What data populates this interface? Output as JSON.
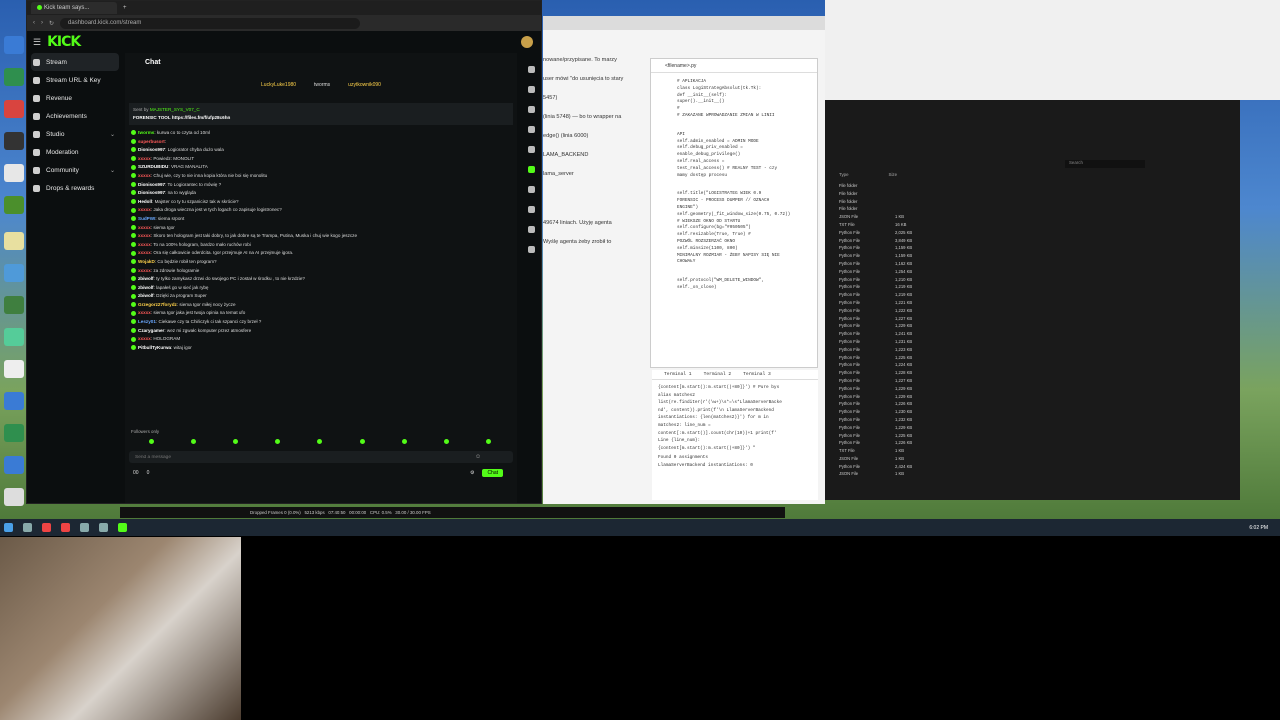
{
  "browser": {
    "tab_title": "Kick team says...",
    "url": "dashboard.kick.com/stream"
  },
  "kick": {
    "logo": "KICK",
    "sidebar": [
      {
        "label": "Stream",
        "icon": "stream-icon",
        "active": true
      },
      {
        "label": "Stream URL & Key",
        "icon": "key-icon"
      },
      {
        "label": "Revenue",
        "icon": "revenue-icon"
      },
      {
        "label": "Achievements",
        "icon": "trophy-icon"
      },
      {
        "label": "Studio",
        "icon": "studio-icon",
        "expandable": true
      },
      {
        "label": "Moderation",
        "icon": "shield-icon"
      },
      {
        "label": "Community",
        "icon": "community-icon",
        "expandable": true
      },
      {
        "label": "Drops & rewards",
        "icon": "gift-icon"
      }
    ],
    "chat": {
      "title": "Chat",
      "top_users": [
        {
          "name": "LuckyLuke1980",
          "value": "1"
        },
        {
          "name": "tworms",
          "value": "1"
        },
        {
          "name": "uzytkownik090",
          "value": "1"
        }
      ],
      "pinned": {
        "sender": "MAJSTER_SYS_V07_C",
        "text": "FORENSIC TOOL https://files.fm/f/ufp28c6hn"
      },
      "messages": [
        {
          "user": "tworms",
          "text": "kurwa co to czyta od 10ml",
          "color": "#53fc18"
        },
        {
          "user": "superbusort",
          "text": "",
          "color": "#ff5a5a"
        },
        {
          "user": "Dionisos997",
          "text": "Logiorator chyba dużo wala",
          "color": "#fff"
        },
        {
          "user": "xxxxx",
          "text": "Powiedz: MONOLIT",
          "color": "#ff5a5a"
        },
        {
          "user": "SZURDUBIDU",
          "text": "VRAG MANALITA",
          "color": "#fff"
        },
        {
          "user": "xxxxx",
          "text": "Chuj wie, czy to nie inna kopia która nie boi się monolitu",
          "color": "#ff5a5a"
        },
        {
          "user": "Dionisos997",
          "text": "To Logiorantec to mówię ?",
          "color": "#fff"
        },
        {
          "user": "Dionisos997",
          "text": "na to wygląda",
          "color": "#fff"
        },
        {
          "user": "Hedoll",
          "text": "Majster co ty tu szpanicisz tak w skrócie?",
          "color": "#fff"
        },
        {
          "user": "xxxxx",
          "text": "Jaka droga wieczna jest w tych logach co zapisuje logistronec?",
          "color": "#ff5a5a"
        },
        {
          "user": "SudPWI",
          "text": "siema srpont",
          "color": "#6aa8ff"
        },
        {
          "user": "xxxxx",
          "text": "siema Igor",
          "color": "#ff5a5a"
        },
        {
          "user": "xxxxx",
          "text": "Skoro ten hologram jest taki dobry, to jak dobre są te Trampa, Putina, Muska i chuj wie kogo jeszcze",
          "color": "#ff5a5a"
        },
        {
          "user": "xxxxx",
          "text": "To na 100% hologram, bardzo mało ruchów robi",
          "color": "#ff5a5a"
        },
        {
          "user": "xxxxx",
          "text": "Ora się całkowicie oderdcita. Igor przejmuje AI na AI przejmuje igora.",
          "color": "#ff5a5a"
        },
        {
          "user": "WojakD",
          "text": "Co będzie robił ten program?",
          "color": "#ffd24a"
        },
        {
          "user": "xxxxx",
          "text": "za zdrowie hologramie",
          "color": "#ff5a5a"
        },
        {
          "user": "zbiwolf",
          "text": "ty tylko zamykasz drzwi do swojego PC i został w środku , to nie krzdzie?",
          "color": "#fff"
        },
        {
          "user": "zbiwolf",
          "text": "lapałeś go w sieć jak rybę",
          "color": "#fff"
        },
        {
          "user": "zbiwolf",
          "text": "Dzięki za program Super",
          "color": "#fff"
        },
        {
          "user": "Grzegorz27forydz",
          "text": "siema Igor miłej nocy życze",
          "color": "#ffd24a"
        },
        {
          "user": "xxxxx",
          "text": "siema Igor jaka jest twoja opinia na temat ufo",
          "color": "#ff5a5a"
        },
        {
          "user": "Leszy01",
          "text": "Ciekawe czy ta Chińczyk ci tak szpanci czy brzeł ?",
          "color": "#6aa8ff"
        },
        {
          "user": "Czarygamer",
          "text": "wez mi zgwałc komputer przez atmosfere",
          "color": "#fff"
        },
        {
          "user": "xxxxx",
          "text": "HOLOGRAM",
          "color": "#ff5a5a"
        },
        {
          "user": "PitbullTyKurwa",
          "text": "witaj igor",
          "color": "#fff"
        }
      ],
      "followers_label": "Followers only",
      "input_placeholder": "Send a message",
      "viewer_count": "00",
      "points": "0",
      "chat_button": "Chat"
    }
  },
  "assistant": {
    "text_lines": [
      "nowane/przypisane. To marzy",
      "user mówi \"do usunięcia to stary",
      "5457)",
      "(linia 5748) — bo to wrapper na",
      "edge()  (linia 6000)",
      "LAMA_BACKEND",
      "lama_server",
      "49674 liniach. Użyję agenta",
      "Wyślę agenta żeby zrobił to"
    ],
    "file_tab": "<filename>.py",
    "code_lines": [
      "#      APLIKACJA",
      "class LogiStrategAbsolut(tk.Tk):",
      "    def __init__(self):",
      "        super().__init__()",
      "#",
      "# ZAKAZANE WPROWADZANIE ZMIAN W LINII",
      "API",
      "self.admin_enabled = ADMIN MODE",
      "self.debug_priv_enabled =",
      "enable_debug_privilege()",
      "self.real_access =",
      "test_real_access() # REALNY TEST - czy",
      "mamy dostęp procesu",
      "self.title(\"LOGISTRATEG WIEK 0.9",
      "FORENSIC - PROCESS DUMPER // OZNACH",
      "ENGINE\")",
      "self.geometry(_fit_window_size(0.75, 0.72))",
      "# WIEKSZE OKNO OD STARTU",
      "self.configure(bg=\"#050505\")",
      "self.resizable(True, True)  #",
      "POZWÓL ROZSZERZAĆ OKNO",
      "self.minsize(1100, 800)",
      "MINIMALNY ROZMIAR - ŻEBY NAPISY SIĘ NIE",
      "CHOWAŁY",
      "self.protocol(\"WM_DELETE_WINDOW\",",
      "self._on_close)"
    ],
    "terminal_tabs": [
      "Terminal 1",
      "Terminal 2",
      "Terminal 3"
    ],
    "terminal_lines": [
      "{content[m.start():m.start()+80]}') # Pure bys",
      "alias matches2",
      "list(re.finditer(r'(\\w+)\\s*=\\s*LlamaServerBacke",
      "nd', content)).print(f'\\n LlamaServerBackend",
      "instantiations: {len(matches2)}') for m in",
      "matches2: line_num =",
      "content[:m.start()].count(chr(10))+1 print(f'",
      "Line {line_num}:",
      "{content[m.start():m.start()+80]}') \"",
      "Found 0 assignments",
      "LlamaServerBackend instantiations: 0"
    ]
  },
  "explorer": {
    "search_placeholder": "Search",
    "col_type": "Type",
    "col_size": "Size",
    "rows": [
      {
        "type": "File folder",
        "size": ""
      },
      {
        "type": "File folder",
        "size": ""
      },
      {
        "type": "File folder",
        "size": ""
      },
      {
        "type": "File folder",
        "size": ""
      },
      {
        "type": "JSON File",
        "size": "1 KB"
      },
      {
        "type": "TXT File",
        "size": "16 KB"
      },
      {
        "type": "Python File",
        "size": "2,025 KB"
      },
      {
        "type": "Python File",
        "size": "3,849 KB"
      },
      {
        "type": "Python File",
        "size": "1,159 KB"
      },
      {
        "type": "Python File",
        "size": "1,159 KB"
      },
      {
        "type": "Python File",
        "size": "1,162 KB"
      },
      {
        "type": "Python File",
        "size": "1,254 KB"
      },
      {
        "type": "Python File",
        "size": "1,210 KB"
      },
      {
        "type": "Python File",
        "size": "1,219 KB"
      },
      {
        "type": "Python File",
        "size": "1,219 KB"
      },
      {
        "type": "Python File",
        "size": "1,221 KB"
      },
      {
        "type": "Python File",
        "size": "1,222 KB"
      },
      {
        "type": "Python File",
        "size": "1,227 KB"
      },
      {
        "type": "Python File",
        "size": "1,229 KB"
      },
      {
        "type": "Python File",
        "size": "1,241 KB"
      },
      {
        "type": "Python File",
        "size": "1,231 KB"
      },
      {
        "type": "Python File",
        "size": "1,223 KB"
      },
      {
        "type": "Python File",
        "size": "1,225 KB"
      },
      {
        "type": "Python File",
        "size": "1,224 KB"
      },
      {
        "type": "Python File",
        "size": "1,228 KB"
      },
      {
        "type": "Python File",
        "size": "1,227 KB"
      },
      {
        "type": "Python File",
        "size": "1,229 KB"
      },
      {
        "type": "Python File",
        "size": "1,229 KB"
      },
      {
        "type": "Python File",
        "size": "1,226 KB"
      },
      {
        "type": "Python File",
        "size": "1,230 KB"
      },
      {
        "type": "Python File",
        "size": "1,232 KB"
      },
      {
        "type": "Python File",
        "size": "1,229 KB"
      },
      {
        "type": "Python File",
        "size": "1,225 KB"
      },
      {
        "type": "Python File",
        "size": "1,226 KB"
      },
      {
        "type": "TXT File",
        "size": "1 KB"
      },
      {
        "type": "JSON File",
        "size": "1 KB"
      },
      {
        "type": "Python File",
        "size": "2,424 KB"
      },
      {
        "type": "JSON File",
        "size": "1 KB"
      }
    ]
  },
  "statusbar": {
    "dropped": "Dropped Frames 0 (0.0%)",
    "bitrate": "5213 kbps",
    "time": "07:40:50",
    "time2": "00:00:00",
    "cpu": "CPU: 0.5%",
    "fps": "30.00 / 30.00 FPS"
  },
  "taskbar": {
    "clock": "6:02 PM"
  },
  "colors": {
    "kick_green": "#53fc18",
    "bg_dark": "#0b0e0f"
  }
}
